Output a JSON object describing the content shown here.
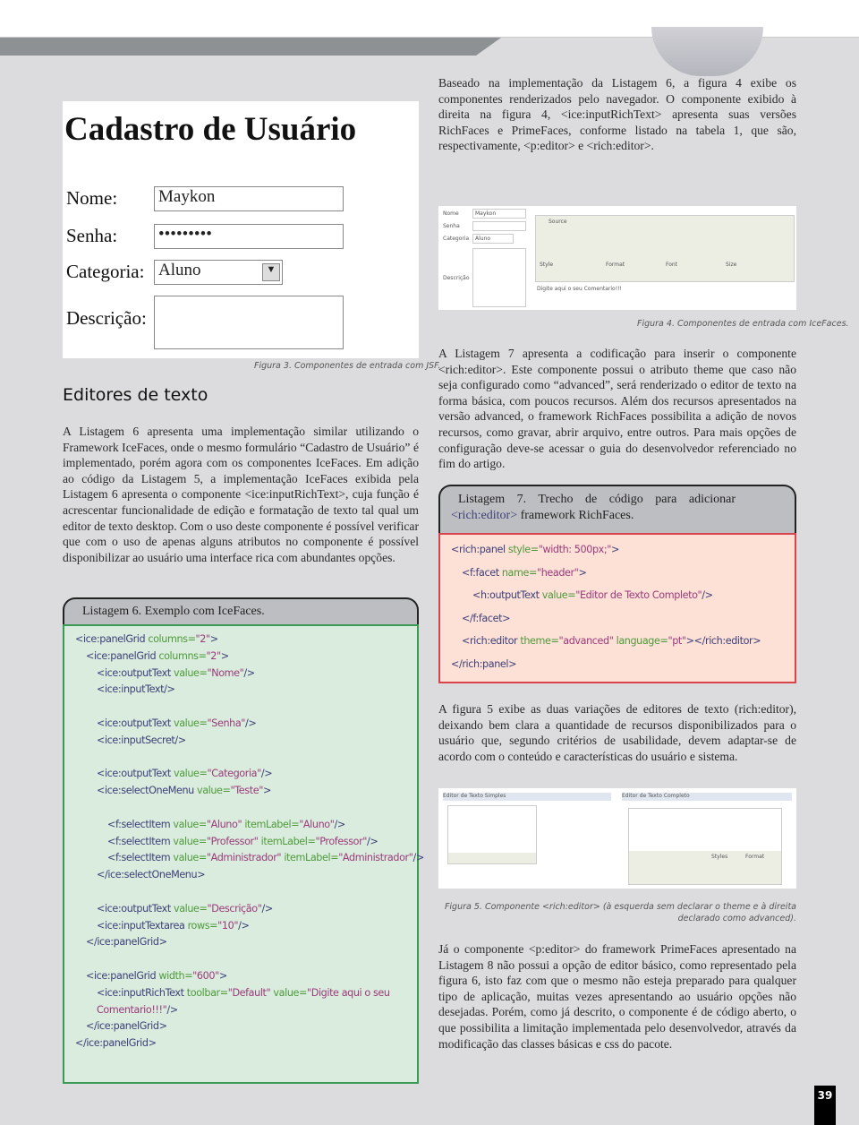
{
  "page_number": "39",
  "section_heading": "Editores de texto",
  "right_col": {
    "p1": "Baseado na implementação da Listagem 6, a figura 4 exibe os componentes renderizados pelo navegador. O componente exibido à direita na figura 4, <ice:inputRichText> apresenta suas versões RichFaces e PrimeFaces, conforme listado na tabela 1, que são, respectivamente, <p:editor> e <rich:editor>.",
    "p2": "A Listagem 7 apresenta a codificação para inserir o componente <rich:editor>. Este componente possui o atributo theme que caso não seja configurado como “advanced”, será renderizado o editor de texto na forma básica, com poucos recursos. Além dos recursos apresentados na versão advanced, o framework RichFaces possibilita a adição de novos recursos, como gravar, abrir arquivo, entre outros. Para mais opções de configuração deve-se acessar o guia do desenvolvedor referenciado no fim do artigo.",
    "p3": "A figura 5 exibe as duas variações de editores de texto (rich:editor), deixando bem clara a quantidade de recursos disponibilizados para o usuário que, segundo critérios de usabilidade, devem adaptar-se de acordo com o conteúdo e características do usuário e sistema.",
    "p4": "Já o componente <p:editor> do framework PrimeFaces apresentado na Listagem 8 não possui a opção de editor básico, como representado pela figura 6, isto faz com que o mesmo não esteja preparado para qualquer tipo de aplicação, muitas vezes apresentando ao usuário opções não desejadas. Porém, como já descrito, o componente é de código aberto, o que possibilita a limitação implementada pelo desenvolvedor, através da modificação das classes básicas e css do pacote."
  },
  "left_col": {
    "p1": "A Listagem 6 apresenta uma implementação similar utilizando o Framework IceFaces, onde o mesmo formulário “Cadastro de Usuário” é implementado, porém agora com os componentes IceFaces. Em adição ao código da Listagem 5, a implementação IceFaces exibida pela Listagem 6 apresenta o componente <ice:inputRichText>, cuja função é acrescentar funcionalidade de edição e formatação de texto tal qual um editor de texto desktop. Com o uso deste componente é possível verificar que com o uso de apenas alguns atributos no componente é possível disponibilizar ao usuário uma interface rica com abundantes opções."
  },
  "figure3": {
    "caption": "Figura 3. Componentes de entrada com JSF.",
    "title": "Cadastro de Usuário",
    "labels": [
      "Nome:",
      "Senha:",
      "Categoria:",
      "Descrição:"
    ],
    "nome_value": "Maykon",
    "senha_value": "•••••••••",
    "categoria_value": "Aluno"
  },
  "figure4": {
    "caption": "Figura 4. Componentes de entrada com IceFaces.",
    "labels": [
      "Nome",
      "Senha",
      "Categoria",
      "Descrição"
    ],
    "nome_value": "Maykon",
    "categoria_value": "Aluno",
    "toolbar": {
      "source": "Source",
      "style": "Style",
      "format": "Format",
      "font": "Font",
      "size": "Size"
    },
    "editor_text": "Digite aqui o seu Comentario!!!"
  },
  "figure5": {
    "caption": "Figura 5. Componente <rich:editor> (à esquerda sem declarar o theme e à direita declarado como advanced).",
    "left_header": "Editor de Texto Simples",
    "right_header": "Editor de Texto Completo",
    "styles": "Styles",
    "format": "Format"
  },
  "listing6": {
    "title": "Listagem 6. Exemplo com IceFaces.",
    "colors": {
      "bg": "#d9ecdd",
      "border": "#3a9a55"
    },
    "lines": [
      {
        "i": 0,
        "s": [
          [
            "tag",
            "<ice:panelGrid "
          ],
          [
            "attr",
            "columns="
          ],
          [
            "val",
            "\"2\""
          ],
          [
            "tag",
            ">"
          ]
        ]
      },
      {
        "i": 1,
        "s": [
          [
            "tag",
            "<ice:panelGrid "
          ],
          [
            "attr",
            "columns="
          ],
          [
            "val",
            "\"2\""
          ],
          [
            "tag",
            ">"
          ]
        ]
      },
      {
        "i": 2,
        "s": [
          [
            "tag",
            "<ice:outputText "
          ],
          [
            "attr",
            "value="
          ],
          [
            "val",
            "\"Nome\""
          ],
          [
            "tag",
            "/>"
          ]
        ]
      },
      {
        "i": 2,
        "s": [
          [
            "tag",
            "<ice:inputText/>"
          ]
        ]
      },
      {
        "i": 0,
        "s": []
      },
      {
        "i": 2,
        "s": [
          [
            "tag",
            "<ice:outputText "
          ],
          [
            "attr",
            "value="
          ],
          [
            "val",
            "\"Senha\""
          ],
          [
            "tag",
            "/>"
          ]
        ]
      },
      {
        "i": 2,
        "s": [
          [
            "tag",
            "<ice:inputSecret/>"
          ]
        ]
      },
      {
        "i": 0,
        "s": []
      },
      {
        "i": 2,
        "s": [
          [
            "tag",
            "<ice:outputText "
          ],
          [
            "attr",
            "value="
          ],
          [
            "val",
            "\"Categoria\""
          ],
          [
            "tag",
            "/>"
          ]
        ]
      },
      {
        "i": 2,
        "s": [
          [
            "tag",
            "<ice:selectOneMenu "
          ],
          [
            "attr",
            "value="
          ],
          [
            "val",
            "\"Teste\""
          ],
          [
            "tag",
            ">"
          ]
        ]
      },
      {
        "i": 0,
        "s": []
      },
      {
        "i": 3,
        "s": [
          [
            "tag",
            "<f:selectItem "
          ],
          [
            "attr",
            "value="
          ],
          [
            "val",
            "\"Aluno\""
          ],
          [
            "attr",
            " itemLabel="
          ],
          [
            "val",
            "\"Aluno\""
          ],
          [
            "tag",
            "/>"
          ]
        ]
      },
      {
        "i": 3,
        "s": [
          [
            "tag",
            "<f:selectItem "
          ],
          [
            "attr",
            "value="
          ],
          [
            "val",
            "\"Professor\""
          ],
          [
            "attr",
            " itemLabel="
          ],
          [
            "val",
            "\"Professor\""
          ],
          [
            "tag",
            "/>"
          ]
        ]
      },
      {
        "i": 3,
        "s": [
          [
            "tag",
            "<f:selectItem "
          ],
          [
            "attr",
            "value="
          ],
          [
            "val",
            "\"Administrador\""
          ],
          [
            "attr",
            " itemLabel="
          ],
          [
            "val",
            "\"Administrador\""
          ],
          [
            "tag",
            "/>"
          ]
        ]
      },
      {
        "i": 2,
        "s": [
          [
            "tag",
            "</ice:selectOneMenu>"
          ]
        ]
      },
      {
        "i": 0,
        "s": []
      },
      {
        "i": 2,
        "s": [
          [
            "tag",
            "<ice:outputText "
          ],
          [
            "attr",
            "value="
          ],
          [
            "val",
            "\"Descrição\""
          ],
          [
            "tag",
            "/>"
          ]
        ]
      },
      {
        "i": 2,
        "s": [
          [
            "tag",
            "<ice:inputTextarea "
          ],
          [
            "attr",
            "rows="
          ],
          [
            "val",
            "\"10\""
          ],
          [
            "tag",
            "/>"
          ]
        ]
      },
      {
        "i": 1,
        "s": [
          [
            "tag",
            "</ice:panelGrid>"
          ]
        ]
      },
      {
        "i": 0,
        "s": []
      },
      {
        "i": 1,
        "s": [
          [
            "tag",
            "<ice:panelGrid "
          ],
          [
            "attr",
            "width="
          ],
          [
            "val",
            "\"600\""
          ],
          [
            "tag",
            ">"
          ]
        ]
      },
      {
        "i": 2,
        "s": [
          [
            "tag",
            "<ice:inputRichText "
          ],
          [
            "attr",
            "toolbar="
          ],
          [
            "val",
            "\"Default\""
          ],
          [
            "attr",
            " value="
          ],
          [
            "val",
            "\"Digite aqui o seu"
          ]
        ]
      },
      {
        "i": 2,
        "s": [
          [
            "val",
            "Comentario!!!\""
          ],
          [
            "tag",
            "/>"
          ]
        ]
      },
      {
        "i": 1,
        "s": [
          [
            "tag",
            "</ice:panelGrid>"
          ]
        ]
      },
      {
        "i": 0,
        "s": [
          [
            "tag",
            "</ice:panelGrid>"
          ]
        ]
      }
    ]
  },
  "listing7": {
    "title_a": "Listagem 7. Trecho de código para adicionar",
    "title_tag": "<rich:editor>",
    "title_b": " framework RichFaces.",
    "colors": {
      "bg": "#fde0d6",
      "border": "#d8434c"
    },
    "lines": [
      {
        "i": 0,
        "s": [
          [
            "tag",
            "<rich:panel "
          ],
          [
            "attr",
            "style="
          ],
          [
            "val",
            "\"width: 500px;\""
          ],
          [
            "tag",
            ">"
          ]
        ]
      },
      {
        "i": 1,
        "s": [
          [
            "tag",
            "<f:facet "
          ],
          [
            "attr",
            "name="
          ],
          [
            "val",
            "\"header\""
          ],
          [
            "tag",
            ">"
          ]
        ]
      },
      {
        "i": 2,
        "s": [
          [
            "tag",
            "<h:outputText "
          ],
          [
            "attr",
            "value="
          ],
          [
            "val",
            "\"Editor de Texto Completo\""
          ],
          [
            "tag",
            "/>"
          ]
        ]
      },
      {
        "i": 1,
        "s": [
          [
            "tag",
            "</f:facet>"
          ]
        ]
      },
      {
        "i": 1,
        "s": [
          [
            "tag",
            "<rich:editor "
          ],
          [
            "attr",
            "theme="
          ],
          [
            "val",
            "\"advanced\""
          ],
          [
            "attr",
            " language="
          ],
          [
            "val",
            "\"pt\""
          ],
          [
            "tag",
            "></rich:editor>"
          ]
        ]
      },
      {
        "i": 0,
        "s": [
          [
            "tag",
            "</rich:panel>"
          ]
        ]
      }
    ]
  }
}
